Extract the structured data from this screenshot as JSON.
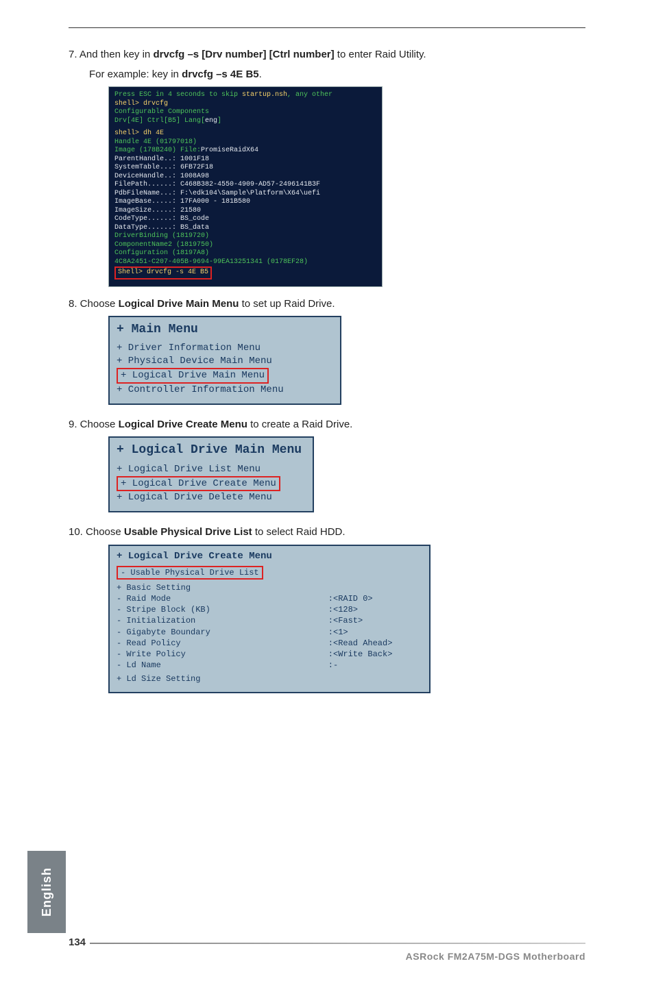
{
  "step7": {
    "num": "7.",
    "text_pre": " And then key in ",
    "cmd1": "drvcfg –s [Drv number] [Ctrl number]",
    "text_mid": " to enter Raid Utility.",
    "line2_pre": "For example: key in ",
    "cmd2": "drvcfg –s 4E B5",
    "line2_post": "."
  },
  "shell": {
    "l01a": "Press ESC in 4 seconds to skip ",
    "l01b": "startup.nsh",
    "l01c": ", any other",
    "l02": "shell> drvcfg",
    "l03": "Configurable Components",
    "l04a": "  Drv[4E]   Ctrl[B5]   Lang[",
    "l04b": "eng",
    "l04c": "]",
    "l05": "shell> dh 4E",
    "l06": "Handle 4E (01797018)",
    "l07a": "    Image (178B240)   File:",
    "l07b": "PromiseRaidX64",
    "l08": "       ParentHandle..: 1001F18",
    "l09": "       SystemTable...: 6FB72F18",
    "l10": "       DeviceHandle..: 1008A98",
    "l11": "       FilePath......: C468B382-4550-4909-AD57-2496141B3F",
    "l12": "       PdbFileName...: F:\\edk104\\Sample\\Platform\\X64\\uefi",
    "l13": "       ImageBase.....: 17FA000 - 181B580",
    "l14": "       ImageSize.....: 21580",
    "l15": "       CodeType......: BS_code",
    "l16": "       DataType......: BS_data",
    "l17": "    DriverBinding (1819720)",
    "l18": "    ComponentName2 (1819750)",
    "l19": "    Configuration (18197A8)",
    "l20": "    4C8A2451-C207-405B-9694-99EA13251341 (0178EF28)",
    "l21": "Shell> drvcfg -s 4E B5"
  },
  "step8": {
    "num": "8.",
    "text_pre": " Choose ",
    "bold": "Logical Drive Main Menu",
    "text_post": " to set up Raid Drive."
  },
  "menu1": {
    "title": "+ Main Menu",
    "r1": "+ Driver Information Menu",
    "r2": "+ Physical Device Main Menu",
    "r3": "+ Logical Drive Main Menu",
    "r4": "+ Controller Information Menu"
  },
  "step9": {
    "num": "9.",
    "text_pre": " Choose ",
    "bold": "Logical Drive Create Menu",
    "text_post": " to create a Raid Drive."
  },
  "menu2": {
    "title": "+ Logical Drive Main Menu",
    "r1": "+ Logical Drive List Menu",
    "r2": "+ Logical Drive Create Menu",
    "r3": "+ Logical Drive Delete Menu"
  },
  "step10": {
    "num": "10.",
    "text_pre": " Choose ",
    "bold": "Usable Physical Drive List",
    "text_post": " to select Raid HDD."
  },
  "menu3": {
    "title": "+ Logical Drive Create Menu",
    "hl": "- Usable Physical Drive List",
    "r1": "+ Basic Setting",
    "r2l": "- Raid Mode",
    "r2r": "<RAID 0>",
    "r3l": "- Stripe Block (KB)",
    "r3r": "<128>",
    "r4l": "- Initialization",
    "r4r": "<Fast>",
    "r5l": "- Gigabyte Boundary",
    "r5r": "<1>",
    "r6l": "- Read Policy",
    "r6r": "<Read Ahead>",
    "r7l": "- Write Policy",
    "r7r": "<Write Back>",
    "r8l": "- Ld Name",
    "r8r": "-",
    "r9": "+ Ld Size Setting"
  },
  "side_tab": "English",
  "page_number": "134",
  "footer_title": "ASRock  FM2A75M-DGS  Motherboard"
}
